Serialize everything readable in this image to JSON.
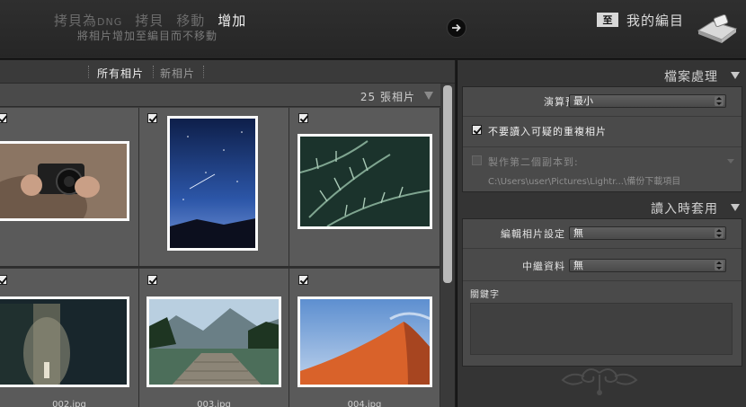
{
  "header": {
    "modes": [
      {
        "label": "拷貝為",
        "suffix": "DNG",
        "active": false
      },
      {
        "label": "拷貝",
        "active": false
      },
      {
        "label": "移動",
        "active": false
      },
      {
        "label": "增加",
        "active": true
      }
    ],
    "mode_description": "將相片增加至編目而不移動",
    "destination_badge": "至",
    "destination_label": "我的編目"
  },
  "filter_tabs": [
    {
      "label": "所有相片",
      "active": true
    },
    {
      "label": "新相片",
      "active": false
    }
  ],
  "photo_count": "25 張相片",
  "photos": [
    {
      "file": "",
      "checked": true
    },
    {
      "file": "",
      "checked": true
    },
    {
      "file": "",
      "checked": true
    },
    {
      "file": "002.jpg",
      "checked": true
    },
    {
      "file": "003.jpg",
      "checked": true
    },
    {
      "file": "004.jpg",
      "checked": true
    }
  ],
  "file_handling": {
    "title": "檔案處理",
    "render_previews_label": "演算預視",
    "render_previews_value": "最小",
    "dont_import_duplicates_label": "不要讀入可疑的重複相片",
    "dont_import_duplicates_checked": true,
    "second_copy_label": "製作第二個副本到:",
    "second_copy_checked": false,
    "second_copy_path": "C:\\Users\\user\\Pictures\\Lightr...\\備份下載項目"
  },
  "apply_during_import": {
    "title": "讀入時套用",
    "develop_settings_label": "編輯相片設定",
    "develop_settings_value": "無",
    "metadata_label": "中繼資料",
    "metadata_value": "無",
    "keywords_label": "關鍵字",
    "keywords_value": ""
  },
  "colors": {
    "accent_active": "#f0f0f0",
    "inactive_text": "#6b6b6b",
    "panel_bg": "#343434"
  }
}
